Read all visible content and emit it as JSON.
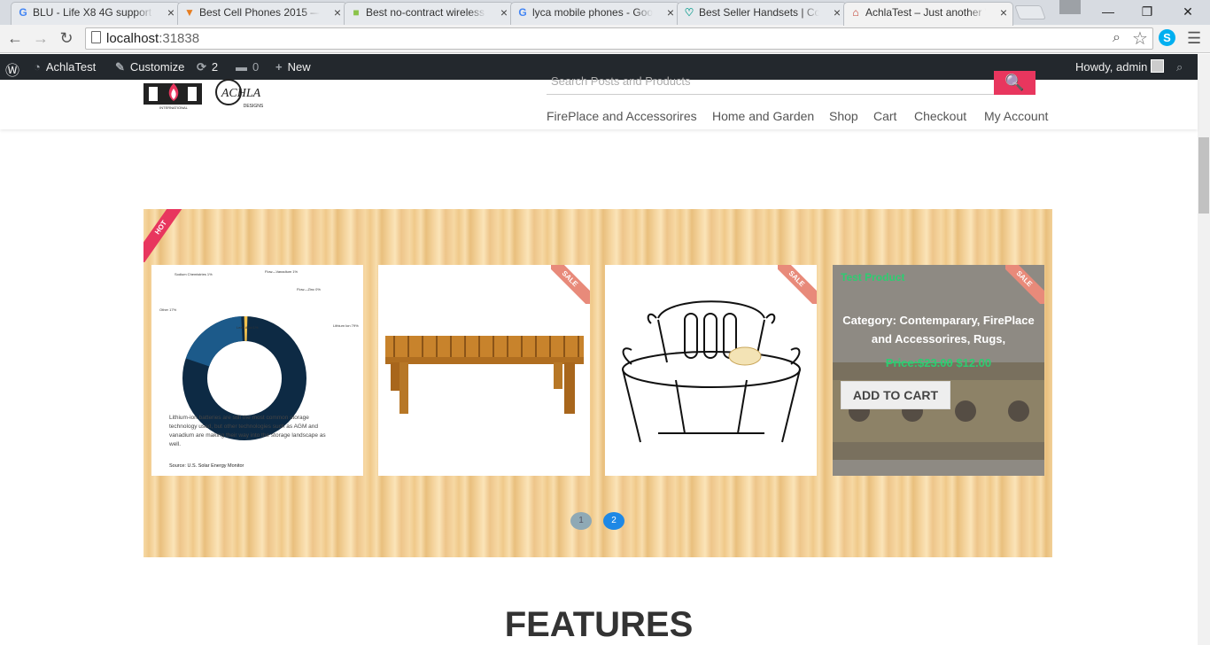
{
  "browser": {
    "tabs": [
      {
        "title": "BLU - Life X8 4G support",
        "favicon": "google-icon",
        "active": false
      },
      {
        "title": "Best Cell Phones 2015 —",
        "favicon": "pizza-icon",
        "active": false
      },
      {
        "title": "Best no-contract wireless",
        "favicon": "chat-icon",
        "active": false
      },
      {
        "title": "lyca mobile phones - Goo",
        "favicon": "google-icon",
        "active": false
      },
      {
        "title": "Best Seller Handsets | Cor",
        "favicon": "heart-icon",
        "active": false
      },
      {
        "title": "AchlaTest – Just another W",
        "favicon": "achla-icon",
        "active": true
      }
    ],
    "url_host": "localhost",
    "url_port": ":31838",
    "window_controls": {
      "minimize": "—",
      "restore": "❐",
      "close": "✕"
    }
  },
  "adminbar": {
    "site_name": "AchlaTest",
    "customize": "Customize",
    "updates_count": "2",
    "comments_count": "0",
    "new_label": "New",
    "greeting": "Howdy, admin"
  },
  "header": {
    "search_placeholder": "Search Posts and Products",
    "logo_text_1": "INTERNATIONAL",
    "logo_text_2": "ACHLA",
    "logo_text_3": "DESIGNS",
    "menu": [
      "FirePlace and Accessorires",
      "Home and Garden",
      "Shop",
      "Cart",
      "Checkout",
      "My Account"
    ]
  },
  "slider": {
    "hot_badge": "HOT",
    "sale_badge": "SALE",
    "chart_card": {
      "labels": [
        "Sodium Chemistries 1%",
        "Flow—Vanadium 1%",
        "Flow—Zinc 0%",
        "Other 17%",
        "Lead Acid 1%",
        "Lithium Ion 79%"
      ],
      "caption": "Lithium-ion batteries are still the most common storage technology used, but other technologies such as AGM and vanadium are making their way into the storage landscape as well.",
      "source": "Source: U.S. Solar Energy Monitor"
    },
    "overlay": {
      "product_name": "Test Product",
      "category": "Category: Contemparary, FirePlace and Accessorires, Rugs,",
      "price_label": "Price:",
      "old_price": "$23.00",
      "new_price": "$12.00",
      "add_to_cart": "ADD TO CART"
    },
    "pagination": [
      "1",
      "2"
    ],
    "active_page": 2
  },
  "sections": {
    "features_title": "FEATURES"
  },
  "colors": {
    "accent": "#e8365e",
    "adminbar": "#23282d",
    "price": "#2ecc71",
    "active_dot": "#1e88e5"
  }
}
